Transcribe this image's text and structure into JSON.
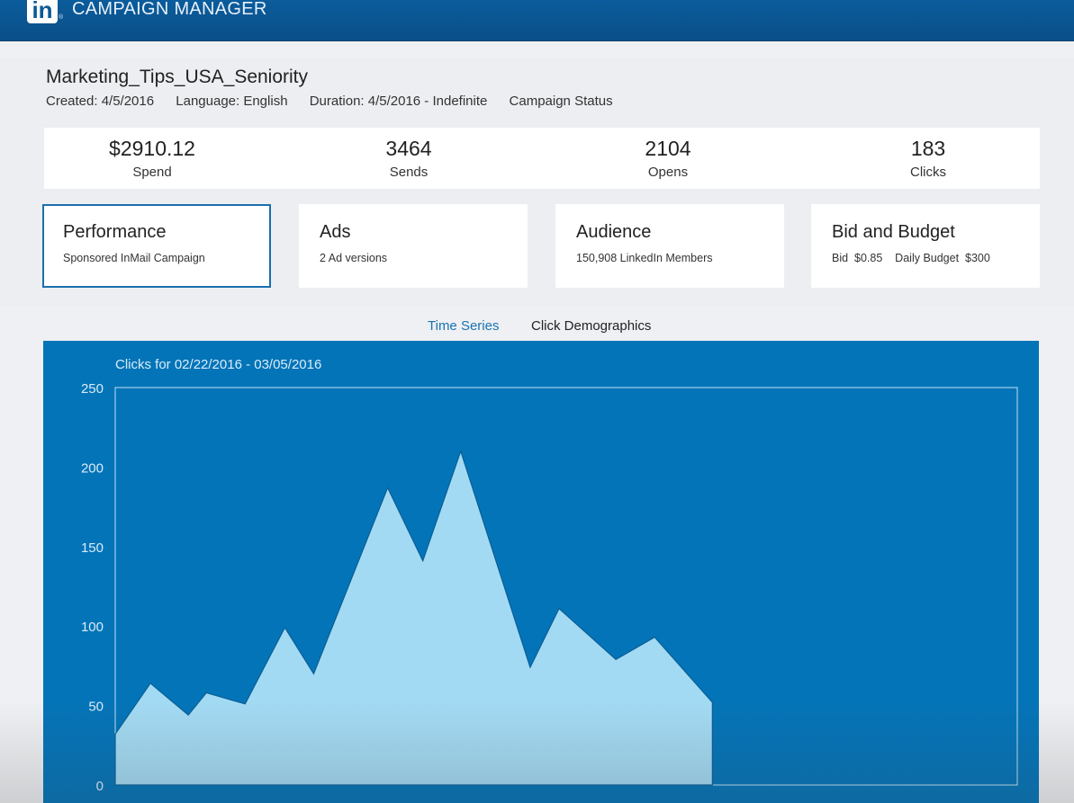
{
  "app": {
    "logo_text": "in",
    "title": "CAMPAIGN MANAGER"
  },
  "campaign": {
    "name": "Marketing_Tips_USA_Seniority",
    "created": "Created: 4/5/2016",
    "language": "Language: English",
    "duration": "Duration: 4/5/2016 - Indefinite",
    "status": "Campaign Status"
  },
  "stats": [
    {
      "value": "$2910.12",
      "label": "Spend"
    },
    {
      "value": "3464",
      "label": "Sends"
    },
    {
      "value": "2104",
      "label": "Opens"
    },
    {
      "value": "183",
      "label": "Clicks"
    }
  ],
  "cards": [
    {
      "title": "Performance",
      "subtitle": "Sponsored InMail Campaign"
    },
    {
      "title": "Ads",
      "subtitle": "2 Ad versions"
    },
    {
      "title": "Audience",
      "subtitle": "150,908 LinkedIn Members"
    },
    {
      "title": "Bid and Budget",
      "subtitle": "Bid  $0.85    Daily Budget  $300"
    }
  ],
  "tabs": {
    "time_series": "Time Series",
    "click_demographics": "Click Demographics"
  },
  "colors": {
    "brand": "#0a5a96",
    "chart_bg": "#0474b8",
    "area_fill": "#a3daf3",
    "tab_active": "#1a73b4"
  },
  "chart_data": {
    "type": "area",
    "title": "Clicks for 02/22/2016  -  03/05/2016",
    "xlabel": "",
    "ylabel": "",
    "ylim": [
      0,
      250
    ],
    "yticks": [
      0,
      50,
      100,
      150,
      200,
      250
    ],
    "xlim": [
      0,
      1
    ],
    "x": [
      0,
      0.039,
      0.081,
      0.101,
      0.144,
      0.188,
      0.22,
      0.302,
      0.341,
      0.383,
      0.46,
      0.492,
      0.555,
      0.598,
      0.662
    ],
    "series": [
      {
        "values": [
          32,
          64,
          44,
          58,
          51,
          99,
          70,
          187,
          141,
          210,
          74,
          111,
          79,
          93,
          52
        ]
      }
    ],
    "grid": false
  }
}
